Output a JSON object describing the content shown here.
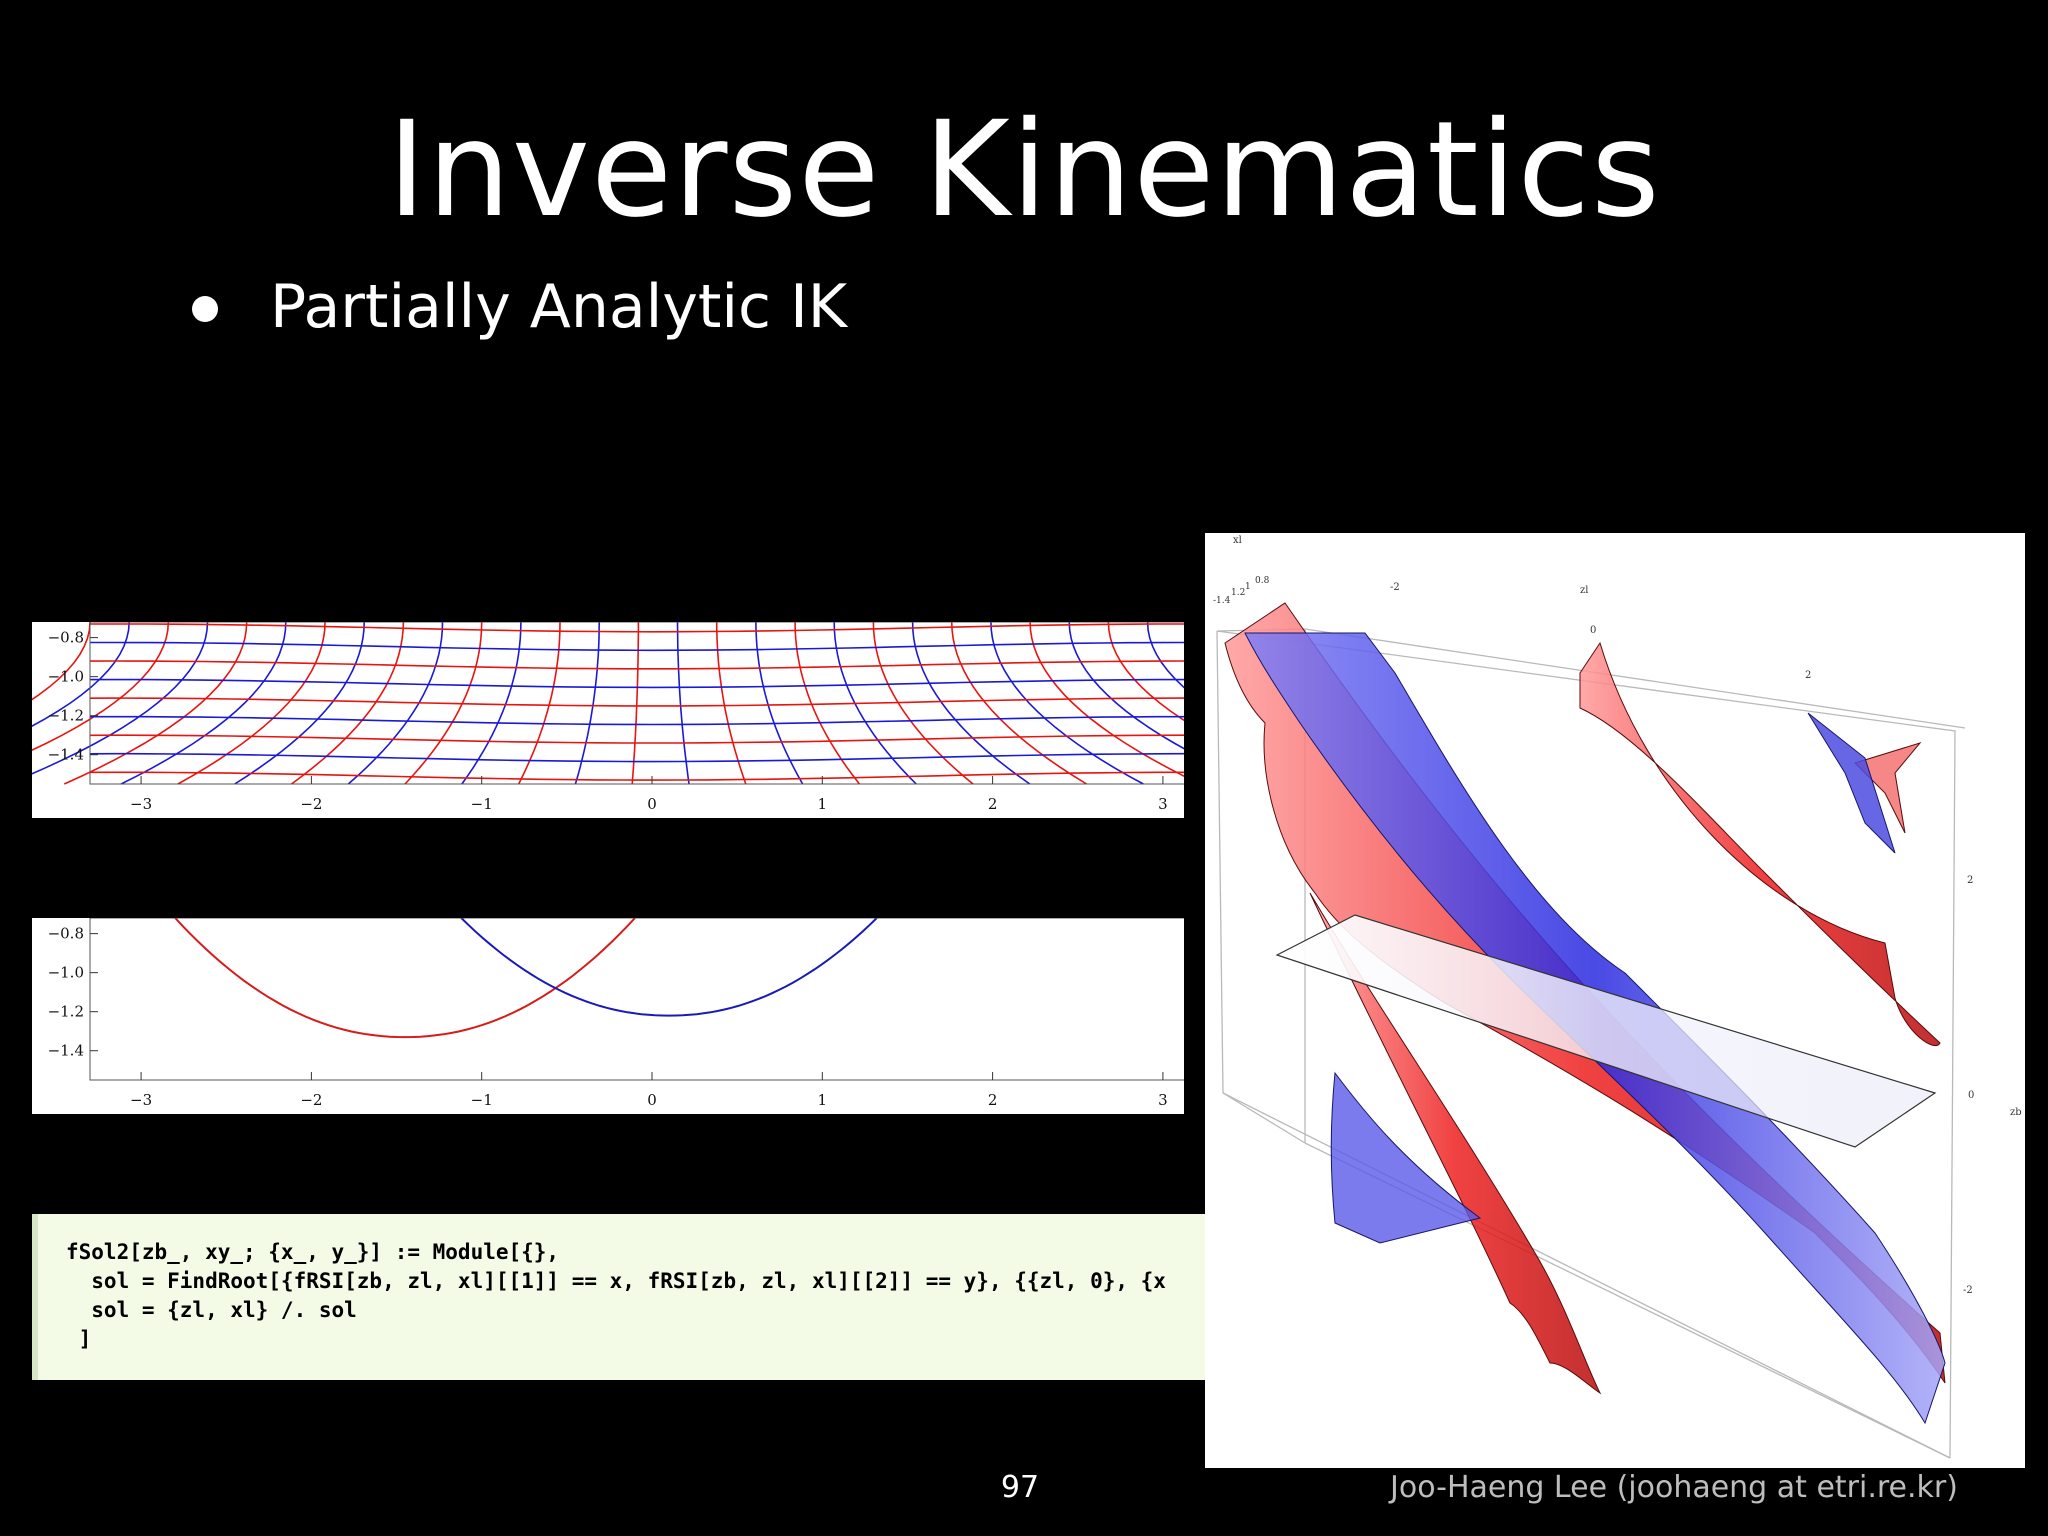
{
  "slide": {
    "title": "Inverse Kinematics",
    "bullet": "Partially Analytic IK",
    "page_number": "97",
    "credit": "Joo-Haeng Lee (joohaeng at etri.re.kr)"
  },
  "plot1": {
    "y_ticks": [
      "-0.8",
      "-1.0",
      "-1.2",
      "-1.4"
    ],
    "x_ticks": [
      "-3",
      "-2",
      "-1",
      "0",
      "1",
      "2",
      "3"
    ]
  },
  "plot2": {
    "y_ticks": [
      "-0.8",
      "-1.0",
      "-1.2",
      "-1.4"
    ],
    "x_ticks": [
      "-3",
      "-2",
      "-1",
      "0",
      "1",
      "2",
      "3"
    ]
  },
  "code": {
    "lines": [
      "fSol2[zb_, xy_; {x_, y_}] := Module[{},",
      "  sol = FindRoot[{fRSI[zb, zl, xl][[1]] == x, fRSI[zb, zl, xl][[2]] == y}, {{zl, 0}, {x",
      "  sol = {zl, xl} /. sol",
      " ]"
    ]
  },
  "plot3d": {
    "axis_labels": {
      "top": "zl",
      "left": "xl",
      "right": "zb"
    },
    "top_ticks": [
      "-2",
      "0",
      "2"
    ],
    "corner_ticks": [
      "-1.4",
      "1.2",
      "1",
      "0.8"
    ],
    "right_ticks": [
      "2",
      "0",
      "-2"
    ]
  },
  "colors": {
    "red": "#e8140f",
    "blue": "#1a1ad6",
    "background": "#000000"
  }
}
